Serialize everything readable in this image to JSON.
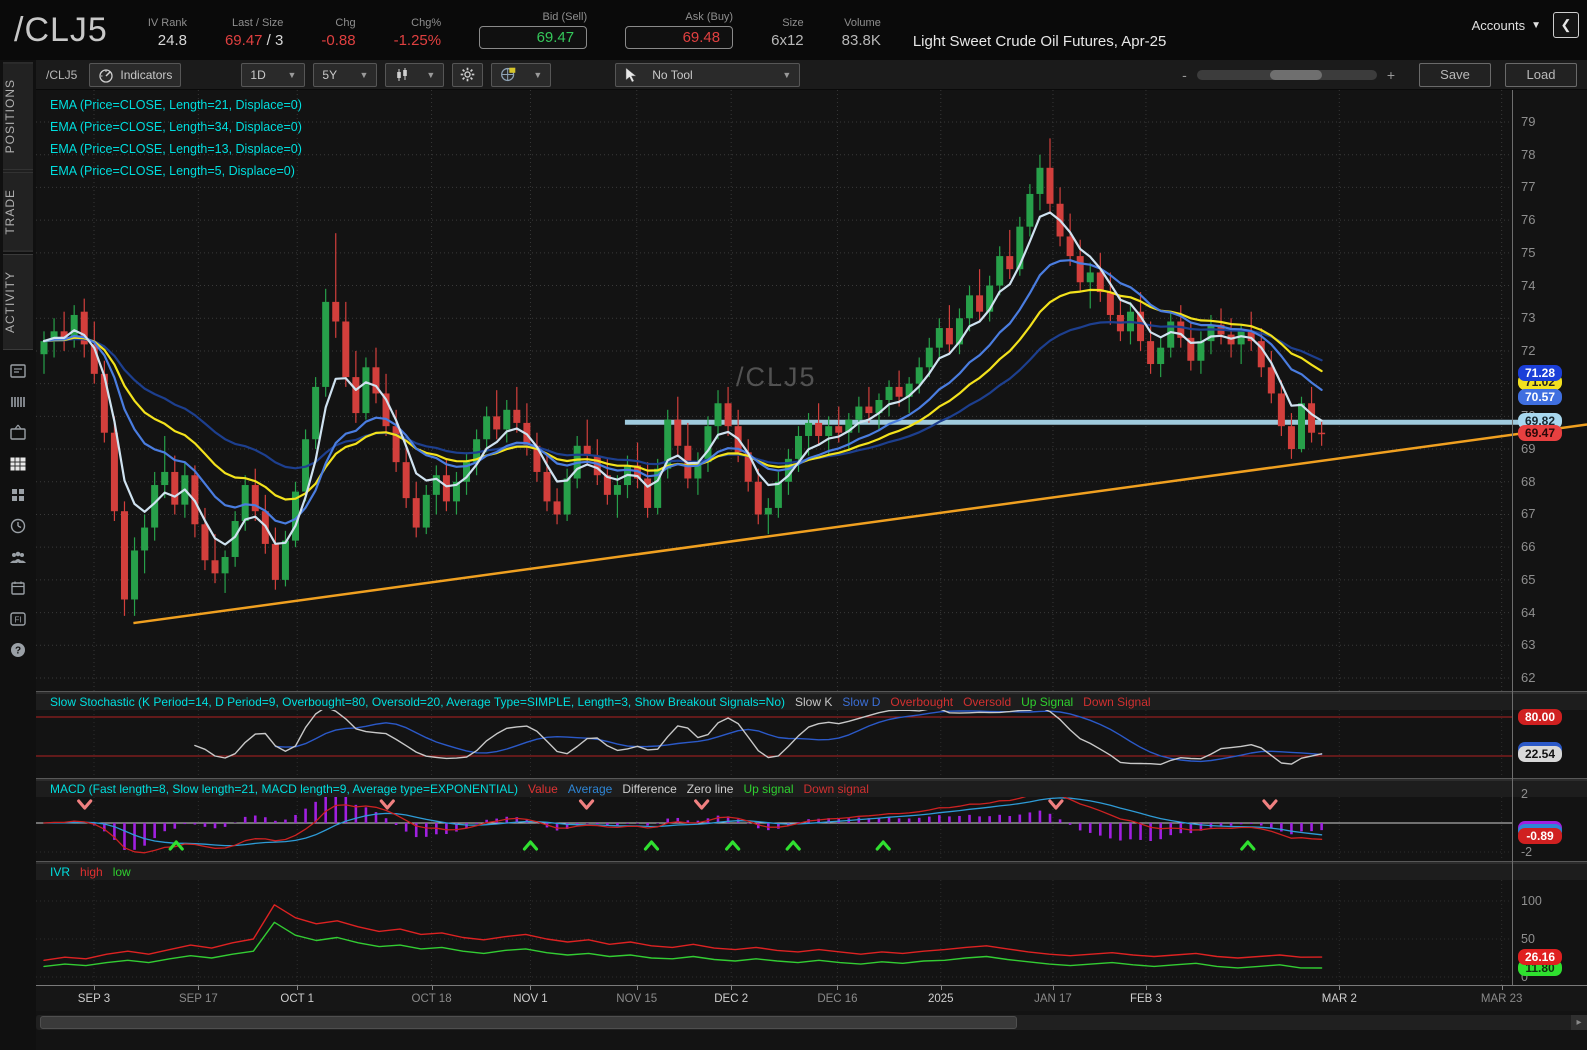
{
  "header": {
    "symbol": "/CLJ5",
    "title": "Light Sweet Crude Oil Futures, Apr-25",
    "accounts_label": "Accounts",
    "collapse_glyph": "❮",
    "fields": [
      {
        "label": "IV Rank",
        "value": "24.8",
        "color": "#d8d8d8"
      },
      {
        "label": "Last / Size",
        "value": "69.47",
        "color": "#e04040",
        "value2": " / 3",
        "color2": "#d8d8d8"
      },
      {
        "label": "Chg",
        "value": "-0.88",
        "color": "#e04040"
      },
      {
        "label": "Chg%",
        "value": "-1.25%",
        "color": "#e04040"
      },
      {
        "label": "Bid (Sell)",
        "value": "69.47",
        "color": "#35c75a",
        "boxed": true
      },
      {
        "label": "Ask (Buy)",
        "value": "69.48",
        "color": "#e04040",
        "boxed": true
      },
      {
        "label": "Size",
        "value": "6x12",
        "color": "#b8b8b8"
      },
      {
        "label": "Volume",
        "value": "83.8K",
        "color": "#b8b8b8"
      }
    ]
  },
  "toolbar": {
    "symbol": "/CLJ5",
    "indicators_label": "Indicators",
    "timeframe": "1D",
    "range": "5Y",
    "tool_label": "No Tool",
    "zoom_minus": "-",
    "zoom_plus": "+",
    "zoom_position_pct": 55,
    "save_label": "Save",
    "load_label": "Load"
  },
  "sidebar": {
    "tabs": [
      "POSITIONS",
      "TRADE",
      "ACTIVITY"
    ],
    "icons": [
      "news-icon",
      "list-icon",
      "tv-icon",
      "chart-grid-icon",
      "grid-squares-icon",
      "clock-icon",
      "people-icon",
      "calendar-icon",
      "fi-icon",
      "help-icon"
    ],
    "active_icon": "chart-grid-icon"
  },
  "chart_data": {
    "type": "candlestick",
    "symbol": "/CLJ5",
    "watermark": "/CLJ5",
    "y_axis": {
      "min": 62,
      "max": 79,
      "step": 1
    },
    "ema_labels": [
      "EMA (Price=CLOSE, Length=21, Displace=0)",
      "EMA (Price=CLOSE, Length=34, Displace=0)",
      "EMA (Price=CLOSE, Length=13, Displace=0)",
      "EMA (Price=CLOSE, Length=5, Displace=0)"
    ],
    "emas": [
      {
        "length": 34,
        "color": "#1d3f8f"
      },
      {
        "length": 21,
        "color": "#f3e21c"
      },
      {
        "length": 13,
        "color": "#4a7de0"
      },
      {
        "length": 5,
        "color": "#cfe2f0"
      }
    ],
    "horizontal_line": {
      "price": 69.82,
      "color": "#9fcadd",
      "x_start_frac": 39.9
    },
    "trendline": {
      "color": "#f0a020",
      "x1_frac": 6.6,
      "price1": 63.68,
      "x2_frac": 100,
      "price2": 69.75
    },
    "price_bubbles": [
      {
        "text": "71.02",
        "price": 71.02,
        "bg": "#f2e020",
        "fg": "#222222"
      },
      {
        "text": "71.28",
        "price": 71.28,
        "bg": "#1b3fd8",
        "fg": "#ffffff"
      },
      {
        "text": "70.57",
        "price": 70.57,
        "bg": "#3f6fe0",
        "fg": "#ffffff"
      },
      {
        "text": "69.82",
        "price": 69.82,
        "bg": "#a8d8ef",
        "fg": "#16262e"
      },
      {
        "text": "69.47",
        "price": 69.47,
        "bg": "#e84040",
        "fg": "#2a0808"
      }
    ],
    "date_ticks": [
      {
        "label": "SEP 3",
        "frac": 3.93,
        "major": true
      },
      {
        "label": "SEP 17",
        "frac": 11.0,
        "major": false
      },
      {
        "label": "OCT 1",
        "frac": 17.7,
        "major": true
      },
      {
        "label": "OCT 18",
        "frac": 26.8,
        "major": false
      },
      {
        "label": "NOV 1",
        "frac": 33.5,
        "major": true
      },
      {
        "label": "NOV 15",
        "frac": 40.7,
        "major": false
      },
      {
        "label": "DEC 2",
        "frac": 47.1,
        "major": true
      },
      {
        "label": "DEC 16",
        "frac": 54.3,
        "major": false
      },
      {
        "label": "2025",
        "frac": 61.3,
        "major": true
      },
      {
        "label": "JAN 17",
        "frac": 68.9,
        "major": false
      },
      {
        "label": "FEB 3",
        "frac": 75.2,
        "major": true
      },
      {
        "label": "MAR 2",
        "frac": 88.3,
        "major": true
      },
      {
        "label": "MAR 23",
        "frac": 99.3,
        "major": false
      }
    ],
    "candles": [
      [
        71.9,
        72.6,
        71.3,
        72.3
      ],
      [
        72.3,
        73.0,
        71.8,
        72.6
      ],
      [
        72.6,
        73.2,
        72.0,
        72.4
      ],
      [
        72.4,
        73.4,
        72.1,
        73.1
      ],
      [
        73.2,
        73.6,
        71.8,
        72.2
      ],
      [
        72.2,
        72.9,
        71.0,
        71.3
      ],
      [
        71.3,
        71.7,
        69.2,
        69.5
      ],
      [
        69.5,
        70.0,
        66.8,
        67.1
      ],
      [
        67.1,
        67.4,
        63.9,
        64.4
      ],
      [
        64.4,
        66.3,
        63.9,
        65.9
      ],
      [
        65.9,
        67.0,
        65.2,
        66.6
      ],
      [
        66.6,
        68.3,
        66.2,
        67.9
      ],
      [
        67.9,
        69.4,
        67.5,
        68.3
      ],
      [
        68.3,
        68.8,
        67.0,
        67.3
      ],
      [
        67.3,
        68.6,
        66.9,
        68.2
      ],
      [
        68.2,
        68.5,
        66.3,
        66.7
      ],
      [
        66.7,
        67.2,
        65.3,
        65.6
      ],
      [
        65.6,
        66.4,
        64.9,
        65.2
      ],
      [
        65.2,
        65.9,
        64.6,
        65.7
      ],
      [
        65.7,
        67.1,
        65.4,
        66.8
      ],
      [
        66.8,
        68.2,
        66.5,
        67.9
      ],
      [
        67.9,
        68.4,
        66.8,
        67.1
      ],
      [
        67.1,
        67.6,
        65.8,
        66.1
      ],
      [
        66.1,
        66.6,
        64.7,
        65.0
      ],
      [
        65.0,
        66.5,
        64.8,
        66.2
      ],
      [
        66.2,
        68.0,
        66.0,
        67.7
      ],
      [
        67.7,
        69.6,
        67.4,
        69.3
      ],
      [
        69.3,
        71.2,
        69.0,
        70.9
      ],
      [
        70.9,
        73.9,
        70.6,
        73.5
      ],
      [
        73.5,
        75.6,
        72.4,
        72.9
      ],
      [
        72.9,
        73.5,
        70.9,
        71.2
      ],
      [
        71.2,
        72.0,
        69.8,
        70.1
      ],
      [
        70.1,
        71.8,
        69.9,
        71.5
      ],
      [
        71.5,
        72.1,
        70.4,
        70.7
      ],
      [
        70.7,
        71.3,
        69.4,
        69.7
      ],
      [
        69.7,
        70.2,
        68.3,
        68.6
      ],
      [
        68.6,
        69.1,
        67.2,
        67.5
      ],
      [
        67.5,
        68.0,
        66.3,
        66.6
      ],
      [
        66.6,
        67.9,
        66.4,
        67.6
      ],
      [
        67.6,
        68.5,
        67.0,
        68.2
      ],
      [
        68.2,
        68.7,
        67.1,
        67.4
      ],
      [
        67.4,
        68.3,
        67.0,
        68.0
      ],
      [
        68.0,
        68.9,
        67.6,
        68.6
      ],
      [
        68.6,
        69.6,
        68.2,
        69.3
      ],
      [
        69.3,
        70.3,
        68.9,
        70.0
      ],
      [
        70.0,
        70.8,
        69.3,
        69.6
      ],
      [
        69.6,
        70.5,
        69.2,
        70.2
      ],
      [
        70.2,
        70.9,
        69.5,
        69.8
      ],
      [
        69.8,
        70.4,
        68.8,
        69.1
      ],
      [
        69.1,
        69.5,
        68.0,
        68.3
      ],
      [
        68.3,
        68.8,
        67.1,
        67.4
      ],
      [
        67.4,
        67.8,
        66.7,
        67.0
      ],
      [
        67.0,
        68.4,
        66.8,
        68.1
      ],
      [
        68.1,
        69.4,
        67.8,
        69.1
      ],
      [
        69.1,
        69.9,
        68.5,
        68.8
      ],
      [
        68.8,
        69.3,
        67.9,
        68.2
      ],
      [
        68.2,
        68.7,
        67.3,
        67.6
      ],
      [
        67.6,
        68.2,
        66.9,
        67.9
      ],
      [
        67.9,
        68.8,
        67.5,
        68.5
      ],
      [
        68.5,
        69.2,
        67.8,
        68.1
      ],
      [
        68.1,
        68.6,
        66.9,
        67.2
      ],
      [
        67.2,
        68.7,
        67.0,
        68.4
      ],
      [
        68.4,
        70.2,
        68.1,
        69.9
      ],
      [
        69.9,
        70.6,
        68.8,
        69.1
      ],
      [
        69.1,
        69.8,
        67.8,
        68.1
      ],
      [
        68.1,
        68.9,
        67.6,
        68.6
      ],
      [
        68.6,
        70.0,
        68.3,
        69.7
      ],
      [
        69.7,
        70.8,
        69.3,
        70.4
      ],
      [
        70.4,
        70.9,
        69.4,
        69.7
      ],
      [
        69.7,
        70.2,
        68.6,
        68.9
      ],
      [
        68.9,
        69.3,
        67.7,
        68.0
      ],
      [
        68.0,
        68.4,
        66.7,
        67.0
      ],
      [
        67.0,
        67.5,
        66.4,
        67.2
      ],
      [
        67.2,
        68.3,
        66.9,
        68.0
      ],
      [
        68.0,
        69.0,
        67.6,
        68.7
      ],
      [
        68.7,
        69.7,
        68.3,
        69.4
      ],
      [
        69.4,
        70.1,
        68.8,
        69.8
      ],
      [
        69.8,
        70.4,
        69.1,
        69.4
      ],
      [
        69.4,
        70.0,
        68.8,
        69.7
      ],
      [
        69.7,
        70.3,
        69.2,
        69.5
      ],
      [
        69.5,
        70.1,
        69.0,
        69.9
      ],
      [
        69.9,
        70.6,
        69.5,
        70.3
      ],
      [
        70.3,
        70.9,
        69.8,
        70.1
      ],
      [
        70.1,
        70.7,
        69.6,
        70.5
      ],
      [
        70.5,
        71.1,
        70.0,
        70.9
      ],
      [
        70.9,
        71.4,
        70.3,
        70.6
      ],
      [
        70.6,
        71.2,
        70.1,
        71.0
      ],
      [
        71.0,
        71.8,
        70.7,
        71.5
      ],
      [
        71.5,
        72.4,
        71.2,
        72.1
      ],
      [
        72.1,
        73.0,
        71.7,
        72.7
      ],
      [
        72.7,
        73.4,
        71.9,
        72.2
      ],
      [
        72.2,
        73.3,
        71.9,
        73.0
      ],
      [
        73.0,
        74.0,
        72.6,
        73.7
      ],
      [
        73.7,
        74.5,
        72.9,
        73.2
      ],
      [
        73.2,
        74.3,
        72.9,
        74.0
      ],
      [
        74.0,
        75.2,
        73.7,
        74.9
      ],
      [
        74.9,
        75.7,
        74.2,
        74.5
      ],
      [
        74.5,
        76.1,
        74.3,
        75.8
      ],
      [
        75.8,
        77.1,
        75.5,
        76.8
      ],
      [
        76.8,
        78.0,
        76.3,
        77.6
      ],
      [
        77.6,
        78.5,
        76.2,
        76.5
      ],
      [
        76.5,
        77.0,
        75.2,
        75.5
      ],
      [
        75.5,
        76.2,
        74.6,
        74.9
      ],
      [
        74.9,
        75.4,
        73.8,
        74.1
      ],
      [
        74.1,
        74.7,
        73.3,
        74.4
      ],
      [
        74.4,
        75.0,
        73.5,
        73.8
      ],
      [
        73.8,
        74.4,
        72.8,
        73.1
      ],
      [
        73.1,
        73.7,
        72.3,
        72.6
      ],
      [
        72.6,
        73.5,
        72.2,
        73.2
      ],
      [
        73.2,
        73.8,
        72.0,
        72.3
      ],
      [
        72.3,
        72.9,
        71.3,
        71.6
      ],
      [
        71.6,
        72.4,
        71.2,
        72.1
      ],
      [
        72.1,
        73.2,
        71.8,
        72.9
      ],
      [
        72.9,
        73.4,
        72.1,
        72.4
      ],
      [
        72.4,
        72.9,
        71.4,
        71.7
      ],
      [
        71.7,
        72.6,
        71.3,
        72.3
      ],
      [
        72.3,
        73.1,
        71.9,
        72.8
      ],
      [
        72.8,
        73.3,
        72.2,
        72.5
      ],
      [
        72.5,
        73.0,
        71.8,
        72.2
      ],
      [
        72.2,
        72.8,
        71.6,
        72.6
      ],
      [
        72.6,
        73.2,
        72.0,
        72.3
      ],
      [
        72.3,
        72.7,
        71.2,
        71.5
      ],
      [
        71.5,
        72.0,
        70.4,
        70.7
      ],
      [
        70.7,
        71.1,
        69.4,
        69.7
      ],
      [
        69.7,
        70.1,
        68.7,
        69.0
      ],
      [
        69.0,
        70.6,
        68.9,
        70.4
      ],
      [
        70.4,
        70.9,
        69.2,
        69.5
      ],
      [
        69.5,
        69.9,
        69.1,
        69.47
      ]
    ],
    "panes": {
      "stochastic": {
        "label": "Slow Stochastic (K Period=14, D Period=9, Overbought=80, Oversold=20, Average Type=SIMPLE, Length=3, Show Breakout Signals=No)",
        "label_color": "#00dede",
        "legend": [
          {
            "text": "Slow K",
            "color": "#c8c8c8"
          },
          {
            "text": "Slow D",
            "color": "#3b6fd6"
          },
          {
            "text": "Overbought",
            "color": "#d03030"
          },
          {
            "text": "Oversold",
            "color": "#d03030"
          },
          {
            "text": "Up Signal",
            "color": "#2fd02f"
          },
          {
            "text": "Down Signal",
            "color": "#d03030"
          }
        ],
        "overbought": 80,
        "oversold": 20,
        "k_color": "#c8c8c8",
        "d_color": "#2b59c8",
        "band_color": "#b22222",
        "ticks": [
          80,
          20
        ],
        "bubbles": [
          {
            "text": "80.00",
            "value": 80,
            "bg": "#d02020",
            "fg": "#ffffff"
          },
          {
            "text": "22.54",
            "value": 22.54,
            "bg": "#d8d8d8",
            "fg": "#111111",
            "backing": "#2b59c8"
          }
        ]
      },
      "macd": {
        "label": "MACD (Fast length=8, Slow length=21, MACD length=9, Average type=EXPONENTIAL)",
        "label_color": "#00dede",
        "legend": [
          {
            "text": "Value",
            "color": "#dd3333"
          },
          {
            "text": "Average",
            "color": "#2e86d6"
          },
          {
            "text": "Difference",
            "color": "#cccccc"
          },
          {
            "text": "Zero line",
            "color": "#cccccc"
          },
          {
            "text": "Up signal",
            "color": "#2fd02f"
          },
          {
            "text": "Down signal",
            "color": "#d03030"
          }
        ],
        "value_color": "#cc2222",
        "average_color": "#2e9bd6",
        "hist_color": "#a020e0",
        "zero_color": "#cfcfcf",
        "ticks": [
          2,
          -2
        ],
        "value_bubble": {
          "text": "-0.89",
          "value": -0.89,
          "bg": "#d02020",
          "fg": "#ffffff",
          "backing": [
            "#a020e0",
            "#2e86d6"
          ]
        },
        "down_arrow_fracs": [
          3.3,
          23.8,
          37.3,
          45.1,
          69.1,
          83.6
        ],
        "up_arrow_fracs": [
          9.5,
          33.5,
          41.7,
          47.2,
          51.3,
          57.4,
          82.1
        ]
      },
      "ivr": {
        "label": "IVR",
        "label_color": "#00dede",
        "legend": [
          {
            "text": "high",
            "color": "#e03030"
          },
          {
            "text": "low",
            "color": "#2fd02f"
          }
        ],
        "high_color": "#dd2222",
        "low_color": "#33cc33",
        "ticks": [
          100,
          50,
          0
        ],
        "bubbles": [
          {
            "text": "26.16",
            "value": 26.16,
            "bg": "#e02020",
            "fg": "#ffffff"
          },
          {
            "text": "11.80",
            "value": 11.8,
            "bg": "#2fe02f",
            "fg": "#103010"
          }
        ],
        "high_series": [
          22,
          26,
          24,
          30,
          34,
          30,
          36,
          42,
          38,
          45,
          50,
          95,
          78,
          70,
          74,
          66,
          60,
          63,
          56,
          58,
          52,
          49,
          53,
          56,
          50,
          46,
          49,
          43,
          46,
          41,
          39,
          43,
          38,
          36,
          39,
          35,
          33,
          36,
          33,
          30,
          33,
          31,
          34,
          36,
          39,
          41,
          37,
          33,
          30,
          28,
          30,
          32,
          29,
          27,
          29,
          31,
          27,
          25,
          27,
          29,
          26,
          26.16
        ],
        "low_series": [
          14,
          17,
          15,
          19,
          22,
          19,
          24,
          28,
          25,
          30,
          34,
          72,
          55,
          48,
          52,
          45,
          40,
          42,
          37,
          39,
          34,
          31,
          35,
          37,
          32,
          29,
          31,
          27,
          29,
          25,
          24,
          27,
          23,
          21,
          24,
          21,
          19,
          22,
          19,
          17,
          20,
          18,
          21,
          22,
          25,
          27,
          23,
          20,
          17,
          15,
          17,
          19,
          16,
          14,
          16,
          18,
          14,
          12,
          14,
          16,
          12,
          11.8
        ]
      }
    }
  }
}
